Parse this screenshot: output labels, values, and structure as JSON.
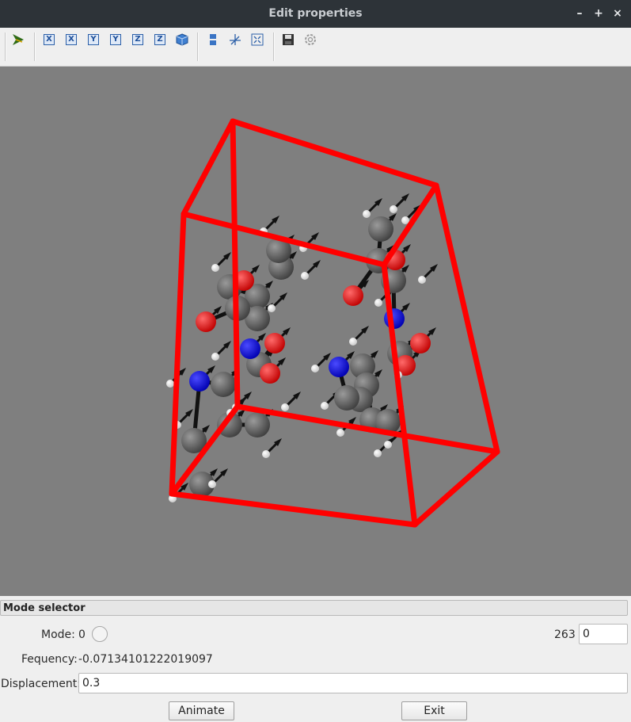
{
  "window": {
    "title": "Edit properties",
    "minimize_glyph": "–",
    "maximize_glyph": "+",
    "close_glyph": "×"
  },
  "toolbar": {
    "icons": [
      "select-arrow-icon",
      "view-x-icon",
      "view-minus-x-icon",
      "view-y-icon",
      "view-minus-y-icon",
      "view-z-icon",
      "view-minus-z-icon",
      "cube-icon",
      "layers-icon",
      "axes-icon",
      "fit-icon",
      "save-icon",
      "settings-icon"
    ],
    "axis_labels": [
      "X",
      "X",
      "Y",
      "Y",
      "Z",
      "Z"
    ]
  },
  "viewport": {
    "background": "#7f7f7f",
    "cell_color": "#ff0000",
    "atom_colors": {
      "carbon": "#555555",
      "oxygen": "#ff0000",
      "nitrogen": "#0000ff",
      "hydrogen": "#ffffff",
      "arrow": "#111111"
    }
  },
  "mode_selector": {
    "header": "Mode selector",
    "mode_label": "Mode:",
    "mode_value": "0",
    "mode_max": "263",
    "mode_input": "0",
    "frequency_label": "Fequency:",
    "frequency_value": "-0.07134101222019097",
    "displacement_label": "Displacement:",
    "displacement_value": "0.3",
    "animate_label": "Animate",
    "exit_label": "Exit"
  }
}
